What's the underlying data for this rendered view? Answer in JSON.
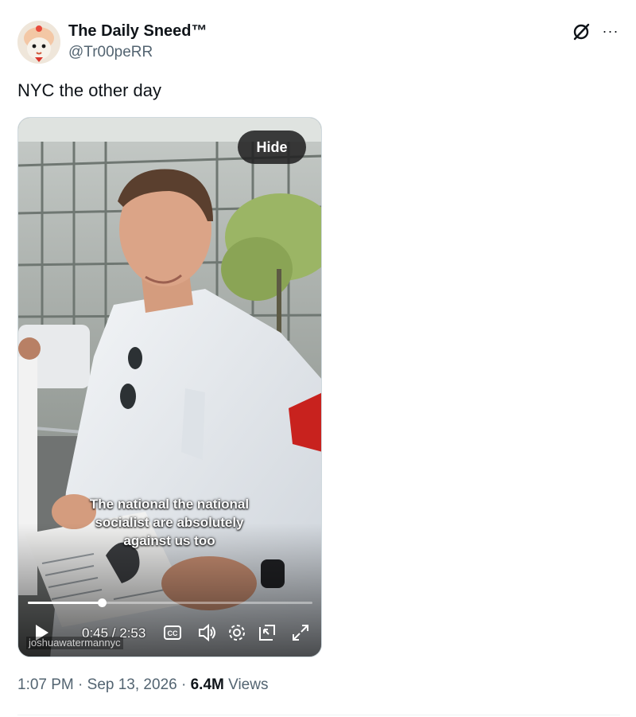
{
  "author": {
    "display_name": "The Daily Sneed™",
    "handle": "@Tr00peRR"
  },
  "actions": {
    "grok_icon": "grok-slash-icon",
    "more": "···"
  },
  "tweet": {
    "text": "NYC the other day"
  },
  "video": {
    "hide_label": "Hide",
    "caption_lines": [
      "The national the national",
      "socialist are absolutely",
      "against us too"
    ],
    "time_display": "0:45 / 2:53",
    "progress": 0.26,
    "watermark": "joshuawatermannyc",
    "controls": [
      "play-icon",
      "cc-icon",
      "volume-icon",
      "settings-icon",
      "pip-icon",
      "fullscreen-icon"
    ]
  },
  "meta": {
    "time": "1:07 PM",
    "separator": "·",
    "date": "Sep 13, 2026",
    "views_count": "6.4M",
    "views_label": "Views"
  },
  "colors": {
    "text_primary": "#0f1419",
    "text_secondary": "#536471",
    "border": "#cfd9de"
  }
}
